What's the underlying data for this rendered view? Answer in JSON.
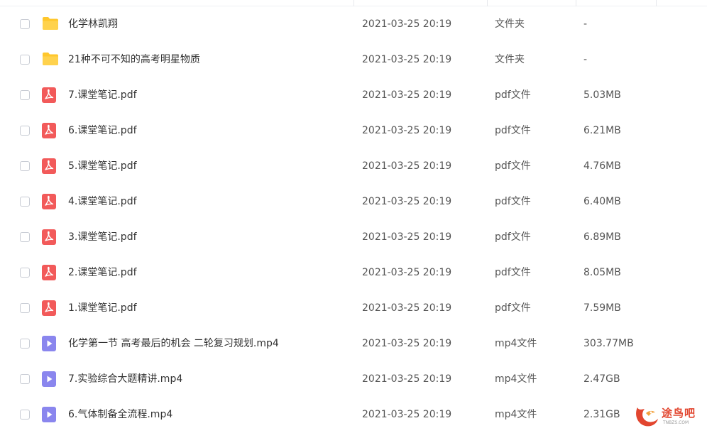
{
  "files": [
    {
      "name": "化学林凯翔",
      "date": "2021-03-25 20:19",
      "type": "文件夹",
      "size": "-",
      "icon": "folder-icon"
    },
    {
      "name": "21种不可不知的高考明星物质",
      "date": "2021-03-25 20:19",
      "type": "文件夹",
      "size": "-",
      "icon": "folder-icon"
    },
    {
      "name": "7.课堂笔记.pdf",
      "date": "2021-03-25 20:19",
      "type": "pdf文件",
      "size": "5.03MB",
      "icon": "pdf-icon"
    },
    {
      "name": "6.课堂笔记.pdf",
      "date": "2021-03-25 20:19",
      "type": "pdf文件",
      "size": "6.21MB",
      "icon": "pdf-icon"
    },
    {
      "name": "5.课堂笔记.pdf",
      "date": "2021-03-25 20:19",
      "type": "pdf文件",
      "size": "4.76MB",
      "icon": "pdf-icon"
    },
    {
      "name": "4.课堂笔记.pdf",
      "date": "2021-03-25 20:19",
      "type": "pdf文件",
      "size": "6.40MB",
      "icon": "pdf-icon"
    },
    {
      "name": "3.课堂笔记.pdf",
      "date": "2021-03-25 20:19",
      "type": "pdf文件",
      "size": "6.89MB",
      "icon": "pdf-icon"
    },
    {
      "name": "2.课堂笔记.pdf",
      "date": "2021-03-25 20:19",
      "type": "pdf文件",
      "size": "8.05MB",
      "icon": "pdf-icon"
    },
    {
      "name": "1.课堂笔记.pdf",
      "date": "2021-03-25 20:19",
      "type": "pdf文件",
      "size": "7.59MB",
      "icon": "pdf-icon"
    },
    {
      "name": "化学第一节 高考最后的机会 二轮复习规划.mp4",
      "date": "2021-03-25 20:19",
      "type": "mp4文件",
      "size": "303.77MB",
      "icon": "video-icon"
    },
    {
      "name": "7.实验综合大题精讲.mp4",
      "date": "2021-03-25 20:19",
      "type": "mp4文件",
      "size": "2.47GB",
      "icon": "video-icon"
    },
    {
      "name": "6.气体制备全流程.mp4",
      "date": "2021-03-25 20:19",
      "type": "mp4文件",
      "size": "2.31GB",
      "icon": "video-icon"
    }
  ],
  "watermark": {
    "text": "途鸟吧",
    "subtext": "TNBZS.COM"
  },
  "colors": {
    "folder": "#ffc72c",
    "pdf": "#f25a5a",
    "video": "#8a86ee",
    "watermark": "#e2462f"
  }
}
